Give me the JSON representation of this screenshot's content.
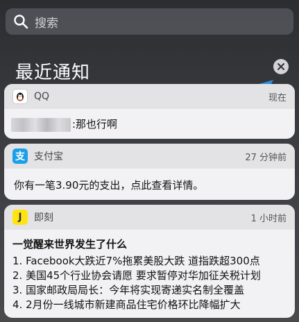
{
  "search": {
    "placeholder": "搜索"
  },
  "section": {
    "title": "最近通知"
  },
  "notifications": [
    {
      "app": "QQ",
      "time": "现在",
      "message": ":那也行啊",
      "icon": "qq-penguin-icon",
      "icon_bg": "#ffffff"
    },
    {
      "app": "支付宝",
      "time": "27 分钟前",
      "message": "你有一笔3.90元的支出，点此查看详情。",
      "icon": "alipay-icon",
      "icon_glyph": "支",
      "icon_bg": "#1a9fe8"
    },
    {
      "app": "即刻",
      "time": "1 小时前",
      "headline": "一觉醒来世界发生了什么",
      "lines": [
        "1. Facebook大跌近7%拖累美股大跌 道指跌超300点",
        "2. 美国45个行业协会请愿 要求暂停对华加征关税计划",
        "3. 国家邮政局局长：今年将实现寄递实名制全覆盖",
        "4. 2月份一线城市新建商品住宅价格环比降幅扩大"
      ],
      "icon": "jike-icon",
      "icon_glyph": "J",
      "icon_bg": "#ffe411"
    }
  ],
  "colors": {
    "annotation_arrow": "#2f8bd8"
  }
}
